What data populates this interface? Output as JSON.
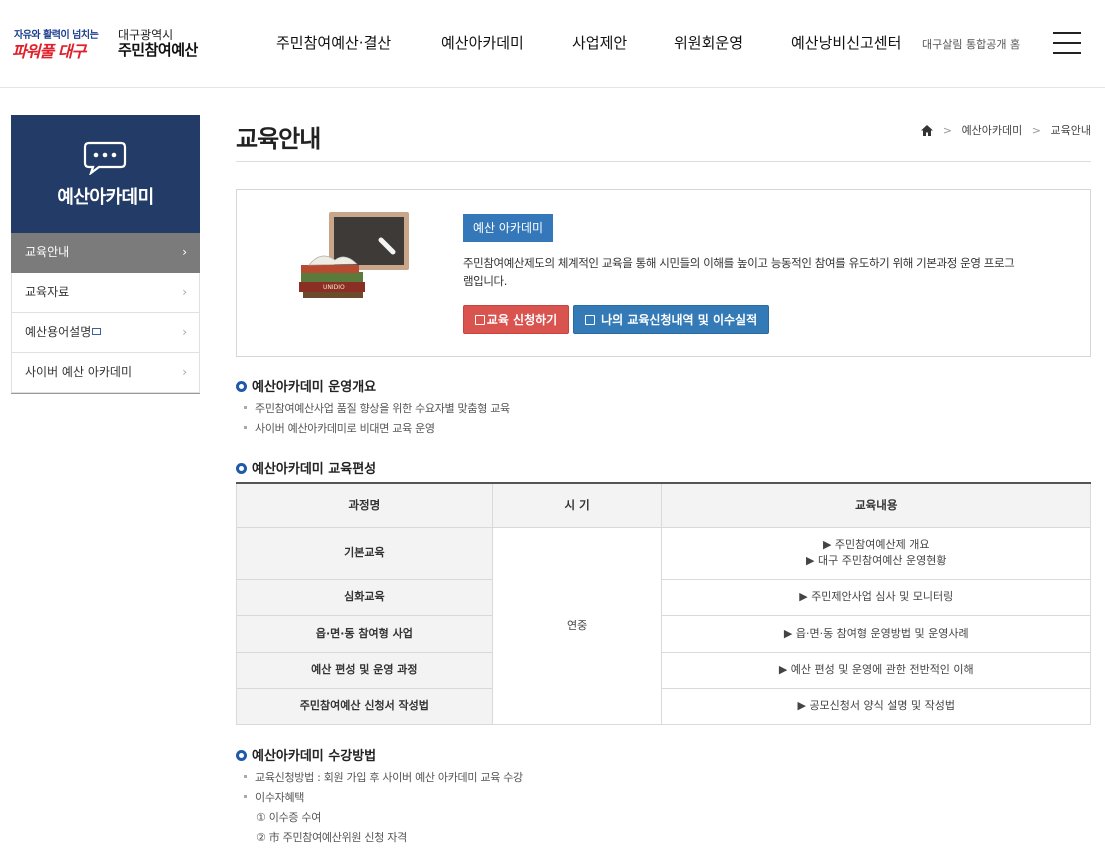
{
  "header": {
    "logo": {
      "slogan_top": "자유와 활력이 넘치는",
      "slogan_main": "파워풀 대구",
      "city": "대구광역시",
      "brand": "주민참여예산"
    },
    "nav": [
      {
        "label": "주민참여예산·결산"
      },
      {
        "label": "예산아카데미"
      },
      {
        "label": "사업제안"
      },
      {
        "label": "위원회운영"
      },
      {
        "label": "예산낭비신고센터"
      }
    ],
    "util_link": "대구살림 통합공개 홈",
    "menu_icon": "hamburger-icon"
  },
  "sidebar": {
    "title": "예산아카데미",
    "icon": "chat-bubble-icon",
    "items": [
      {
        "label": "교육안내",
        "active": true
      },
      {
        "label": "교육자료",
        "active": false
      },
      {
        "label": "예산용어설명",
        "active": false
      },
      {
        "label": "사이버 예산 아카데미",
        "active": false
      }
    ]
  },
  "page": {
    "title": "교육안내",
    "breadcrumb": [
      "예산아카데미",
      "교육안내"
    ]
  },
  "intro": {
    "badge": "예산 아카데미",
    "description": "주민참여예산제도의 체계적인 교육을 통해 시민들의 이해를 높이고 능동적인 참여를 유도하기 위해 기본과정 운영 프로그램입니다.",
    "apply_button": "교육 신청하기",
    "history_button": "나의 교육신청내역 및 이수실적"
  },
  "overview": {
    "title": "예산아카데미 운영개요",
    "items": [
      "주민참여예산사업 품질 향상을 위한 수요자별 맞춤형 교육",
      "사이버 예산아카데미로 비대면 교육 운영"
    ]
  },
  "curriculum": {
    "title": "예산아카데미 교육편성",
    "headers": [
      "과정명",
      "시 기",
      "교육내용"
    ],
    "period": "연중",
    "rows": [
      {
        "course": "기본교육",
        "content_line1": "▶ 주민참여예산제 개요",
        "content_line2": "▶ 대구 주민참여예산 운영현황"
      },
      {
        "course": "심화교육",
        "content_line1": "▶ 주민제안사업 심사 및 모니터링"
      },
      {
        "course": "읍·면·동 참여형 사업",
        "content_line1": "▶ 읍·면·동 참여형 운영방법 및 운영사례"
      },
      {
        "course": "예산 편성 및 운영 과정",
        "content_line1": "▶ 예산 편성 및 운영에 관한 전반적인 이해"
      },
      {
        "course": "주민참여예산 신청서 작성법",
        "content_line1": "▶ 공모신청서 양식 설명 및 작성법"
      }
    ]
  },
  "method": {
    "title": "예산아카데미 수강방법",
    "item1": "교육신청방법 : 회원 가입 후 사이버 예산 아카데미 교육 수강",
    "item2": "이수자혜택",
    "sub1": "① 이수증 수여",
    "sub2": "② 市 주민참여예산위원 신청 자격"
  },
  "colors": {
    "sidebar_bg": "#233c67",
    "active_item_bg": "#7b7b7b",
    "badge_blue": "#3478ba",
    "button_red": "#d9534f",
    "button_blue": "#337ab7",
    "section_dot": "#1e5aa8",
    "logo_red": "#e0202a",
    "logo_navy": "#1d3f8f"
  }
}
